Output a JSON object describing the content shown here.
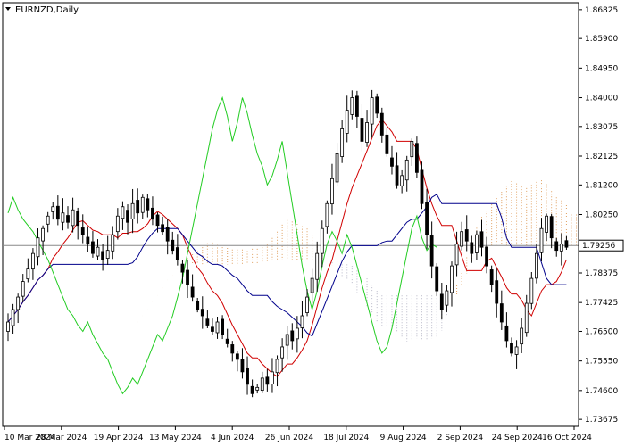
{
  "chart_data": {
    "type": "candlestick",
    "symbol_label": "EURNZD,Daily",
    "current_price": "1.79256",
    "y_ticks": [
      "1.86825",
      "1.85900",
      "1.84950",
      "1.84000",
      "1.83075",
      "1.82125",
      "1.81200",
      "1.80250",
      "1.79300",
      "1.78375",
      "1.77425",
      "1.76500",
      "1.75550",
      "1.74600",
      "1.73675"
    ],
    "x_ticks": [
      "10 Mar 2024",
      "28 Mar 2024",
      "19 Apr 2024",
      "13 May 2024",
      "4 Jun 2024",
      "26 Jun 2024",
      "18 Jul 2024",
      "9 Aug 2024",
      "2 Sep 2024",
      "24 Sep 2024",
      "16 Oct 2024"
    ],
    "ylim": [
      1.7345,
      1.8705
    ],
    "indicators": [
      "Ichimoku Kinko Hyo: Tenkan-sen (red), Kijun-sen (blue), Chikou Span (green), Kumo cloud (orange/grey dotted)"
    ],
    "colors": {
      "tenkan": "#d00000",
      "kijun": "#00008b",
      "chikou": "#22cc22",
      "cloud_bull": "#e0a060",
      "cloud_bear": "#b8b8c8",
      "candle": "#000000",
      "price_line": "#888888"
    },
    "closes": [
      1.768,
      1.772,
      1.776,
      1.781,
      1.785,
      1.79,
      1.795,
      1.798,
      1.802,
      1.805,
      1.801,
      1.803,
      1.8,
      1.804,
      1.799,
      1.796,
      1.793,
      1.79,
      1.792,
      1.788,
      1.791,
      1.796,
      1.802,
      1.805,
      1.8,
      1.806,
      1.803,
      1.808,
      1.804,
      1.801,
      1.799,
      1.797,
      1.794,
      1.791,
      1.788,
      1.784,
      1.78,
      1.776,
      1.772,
      1.77,
      1.767,
      1.765,
      1.768,
      1.764,
      1.761,
      1.758,
      1.756,
      1.752,
      1.748,
      1.745,
      1.747,
      1.75,
      1.748,
      1.752,
      1.756,
      1.76,
      1.764,
      1.762,
      1.766,
      1.77,
      1.776,
      1.782,
      1.79,
      1.798,
      1.806,
      1.814,
      1.822,
      1.83,
      1.836,
      1.84,
      1.834,
      1.826,
      1.832,
      1.84,
      1.835,
      1.828,
      1.822,
      1.818,
      1.812,
      1.815,
      1.82,
      1.826,
      1.816,
      1.806,
      1.796,
      1.786,
      1.778,
      1.772,
      1.778,
      1.786,
      1.793,
      1.797,
      1.794,
      1.79,
      1.796,
      1.792,
      1.786,
      1.78,
      1.774,
      1.768,
      1.762,
      1.758,
      1.76,
      1.766,
      1.774,
      1.782,
      1.79,
      1.798,
      1.802,
      1.795,
      1.791,
      1.793,
      1.792
    ]
  }
}
